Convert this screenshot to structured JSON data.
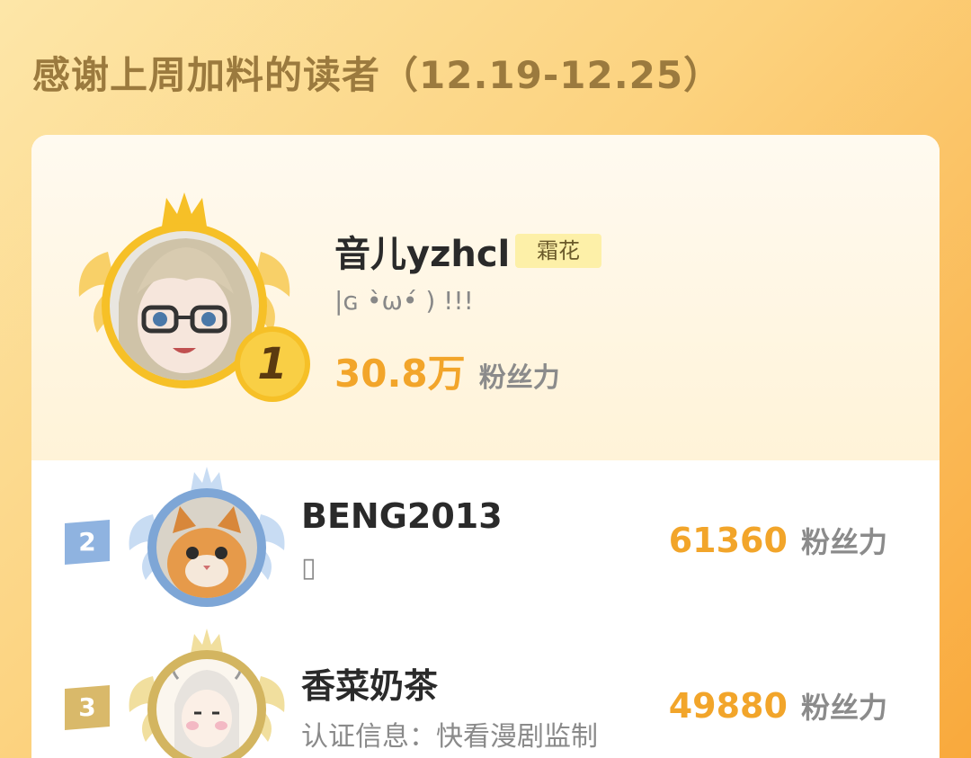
{
  "header": {
    "title": "感谢上周加料的读者（12.19-12.25）"
  },
  "top_reader": {
    "rank": "1",
    "name": "音儿yzhcl",
    "tag": "霜花",
    "motto": "|ɢ •̀ω•́ ) !!!",
    "score_value": "30.8万",
    "score_unit": "粉丝力"
  },
  "readers": [
    {
      "rank": "2",
      "name": "BENG2013",
      "subtitle": "▯",
      "score_value": "61360",
      "score_unit": "粉丝力"
    },
    {
      "rank": "3",
      "name": "香菜奶茶",
      "subtitle": "认证信息：快看漫剧监制",
      "score_value": "49880",
      "score_unit": "粉丝力"
    }
  ],
  "colors": {
    "accent": "#f2a52a",
    "gold": "#f6c027",
    "silver_badge": "#8fb3e0",
    "bronze_badge": "#d9b96a"
  }
}
